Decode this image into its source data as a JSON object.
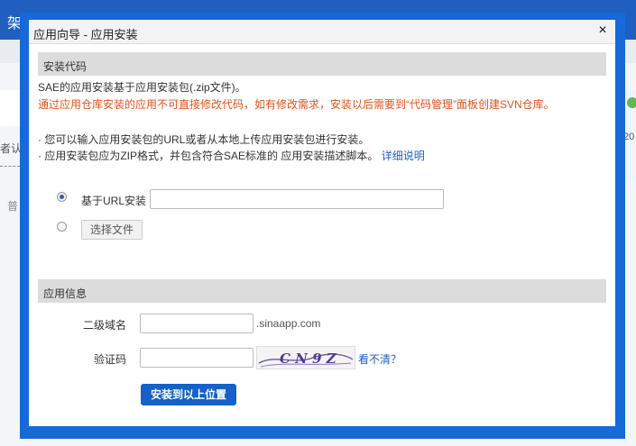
{
  "background": {
    "topbar_title": "架",
    "left_text": "者认",
    "left_tab": "普",
    "right_number": "20"
  },
  "modal": {
    "title": "应用向导 - 应用安装",
    "close_label": "×",
    "install_code": {
      "section_title": "安装代码",
      "intro": "SAE的应用安装基于应用安装包(.zip文件)。",
      "warning": "通过应用仓库安装的应用不可直接修改代码，如有修改需求，安装以后需要到“代码管理”面板创建SVN仓库。",
      "bullet1": "· 您可以输入应用安装包的URL或者从本地上传应用安装包进行安装。",
      "bullet2_text": "· 应用安装包应为ZIP格式，并包含符合SAE标准的 应用安装描述脚本。",
      "bullet2_link": "详细说明",
      "url_option_label": "基于URL安装",
      "url_value": "",
      "file_button_label": "选择文件"
    },
    "app_info": {
      "section_title": "应用信息",
      "subdomain_label": "二级域名",
      "subdomain_value": "",
      "subdomain_suffix": ".sinaapp.com",
      "captcha_label": "验证码",
      "captcha_value": "",
      "captcha_text": "CN9Z",
      "refresh_link": "看不清？",
      "submit_label": "安装到以上位置"
    }
  },
  "colors": {
    "frame_blue": "#1669d6",
    "warning_red": "#e4521b",
    "link_blue": "#1f5fbf",
    "button_blue": "#1560c9"
  }
}
